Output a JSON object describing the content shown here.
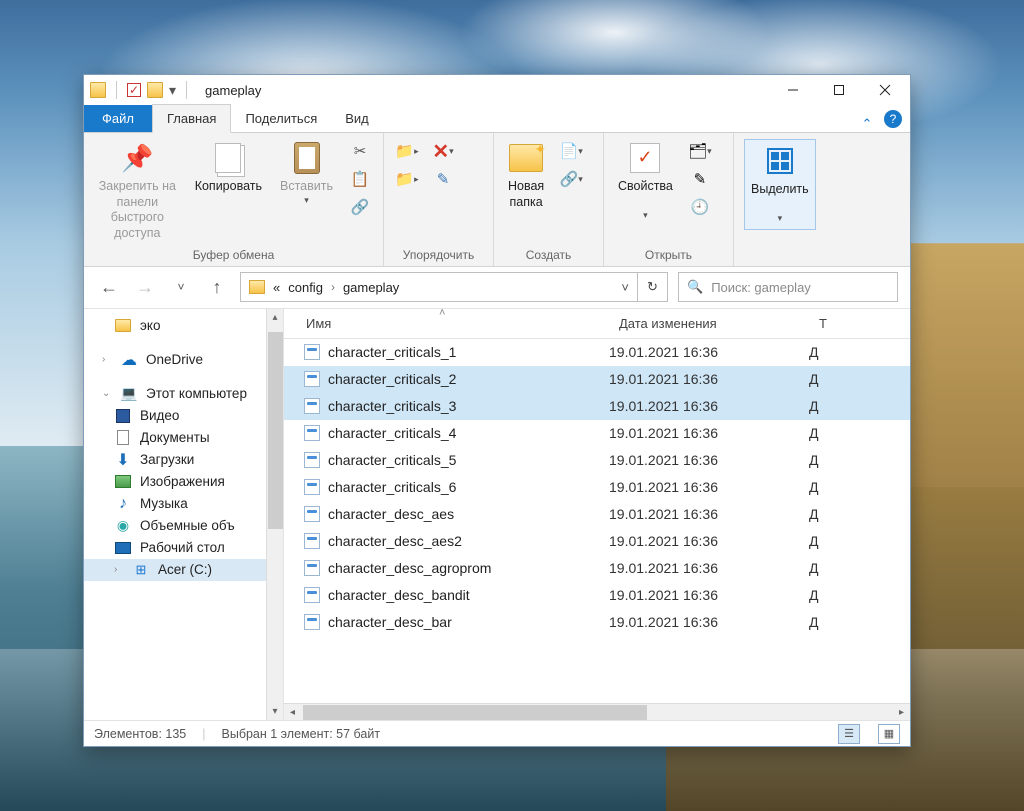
{
  "window": {
    "title": "gameplay"
  },
  "ribbon_tabs": {
    "file": "Файл",
    "home": "Главная",
    "share": "Поделиться",
    "view": "Вид"
  },
  "ribbon": {
    "pin": "Закрепить на панели\nбыстрого доступа",
    "copy": "Копировать",
    "paste": "Вставить",
    "clipboard_group": "Буфер обмена",
    "organize_group": "Упорядочить",
    "newfolder": "Новая\nпапка",
    "create_group": "Создать",
    "properties": "Свойства",
    "open_group": "Открыть",
    "select": "Выделить"
  },
  "address": {
    "prefix": "«",
    "crumb1": "config",
    "crumb2": "gameplay"
  },
  "search": {
    "placeholder": "Поиск: gameplay"
  },
  "nav": {
    "eco": "эко",
    "onedrive": "OneDrive",
    "this_pc": "Этот компьютер",
    "video": "Видео",
    "documents": "Документы",
    "downloads": "Загрузки",
    "images": "Изображения",
    "music": "Музыка",
    "objects3d": "Объемные объ",
    "desktop": "Рабочий стол",
    "drive_c": "Acer (C:)"
  },
  "columns": {
    "name": "Имя",
    "date": "Дата изменения",
    "type": "Т"
  },
  "files": [
    {
      "name": "character_criticals_1",
      "date": "19.01.2021 16:36",
      "type": "Д",
      "sel": false
    },
    {
      "name": "character_criticals_2",
      "date": "19.01.2021 16:36",
      "type": "Д",
      "sel": true
    },
    {
      "name": "character_criticals_3",
      "date": "19.01.2021 16:36",
      "type": "Д",
      "sel": true
    },
    {
      "name": "character_criticals_4",
      "date": "19.01.2021 16:36",
      "type": "Д",
      "sel": false
    },
    {
      "name": "character_criticals_5",
      "date": "19.01.2021 16:36",
      "type": "Д",
      "sel": false
    },
    {
      "name": "character_criticals_6",
      "date": "19.01.2021 16:36",
      "type": "Д",
      "sel": false
    },
    {
      "name": "character_desc_aes",
      "date": "19.01.2021 16:36",
      "type": "Д",
      "sel": false
    },
    {
      "name": "character_desc_aes2",
      "date": "19.01.2021 16:36",
      "type": "Д",
      "sel": false
    },
    {
      "name": "character_desc_agroprom",
      "date": "19.01.2021 16:36",
      "type": "Д",
      "sel": false
    },
    {
      "name": "character_desc_bandit",
      "date": "19.01.2021 16:36",
      "type": "Д",
      "sel": false
    },
    {
      "name": "character_desc_bar",
      "date": "19.01.2021 16:36",
      "type": "Д",
      "sel": false
    }
  ],
  "status": {
    "items": "Элементов: 135",
    "selected": "Выбран 1 элемент: 57 байт"
  }
}
